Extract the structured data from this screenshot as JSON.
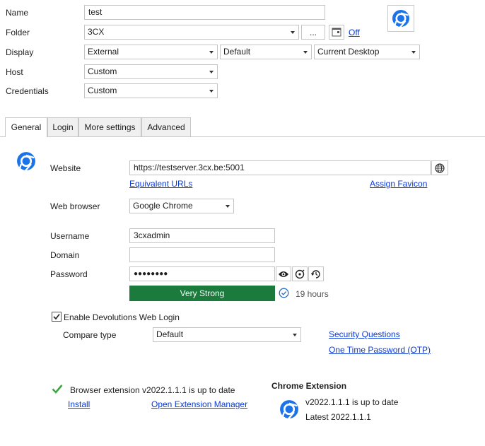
{
  "header": {
    "name_label": "Name",
    "name_value": "test",
    "folder_label": "Folder",
    "folder_value": "3CX",
    "folder_browse_label": "...",
    "folder_toggle_label": "Off",
    "display_label": "Display",
    "display_value": "External",
    "display_mode_value": "Default",
    "display_monitor_value": "Current Desktop",
    "host_label": "Host",
    "host_value": "Custom",
    "credentials_label": "Credentials",
    "credentials_value": "Custom",
    "entry_icon": "chrome-icon"
  },
  "tabs": [
    {
      "label": "General",
      "active": true
    },
    {
      "label": "Login",
      "active": false
    },
    {
      "label": "More settings",
      "active": false
    },
    {
      "label": "Advanced",
      "active": false
    }
  ],
  "general": {
    "section_icon": "chrome-icon",
    "website_label": "Website",
    "website_value": "https://testserver.3cx.be:5001",
    "website_globe_icon": "globe-icon",
    "equivalent_urls_link": "Equivalent URLs",
    "assign_favicon_link": "Assign Favicon",
    "web_browser_label": "Web browser",
    "web_browser_value": "Google Chrome",
    "username_label": "Username",
    "username_value": "3cxadmin",
    "domain_label": "Domain",
    "domain_value": "",
    "password_label": "Password",
    "password_value": "●●●●●●●●",
    "password_icons": [
      "eye-icon",
      "password-generator-icon",
      "password-history-icon"
    ],
    "strength_label": "Very Strong",
    "strength_color": "#1a7b3c",
    "crack_time_icon": "clock-check-icon",
    "crack_time": "19 hours",
    "enable_web_login_label": "Enable Devolutions Web Login",
    "enable_web_login_checked": true,
    "compare_type_label": "Compare type",
    "compare_type_value": "Default",
    "security_questions_link": "Security Questions",
    "otp_link": "One Time Password (OTP)"
  },
  "extension": {
    "status_icon": "checkmark-icon",
    "status_text": "Browser extension v2022.1.1.1 is up to date",
    "install_link": "Install",
    "open_manager_link": "Open Extension Manager",
    "chrome_title": "Chrome Extension",
    "chrome_icon": "chrome-icon",
    "chrome_status": "v2022.1.1.1 is up to date",
    "chrome_latest": "Latest 2022.1.1.1"
  },
  "colors": {
    "link": "#0b3ad4",
    "chrome_blue": "#1a73e8",
    "check_green": "#3aa83a"
  }
}
